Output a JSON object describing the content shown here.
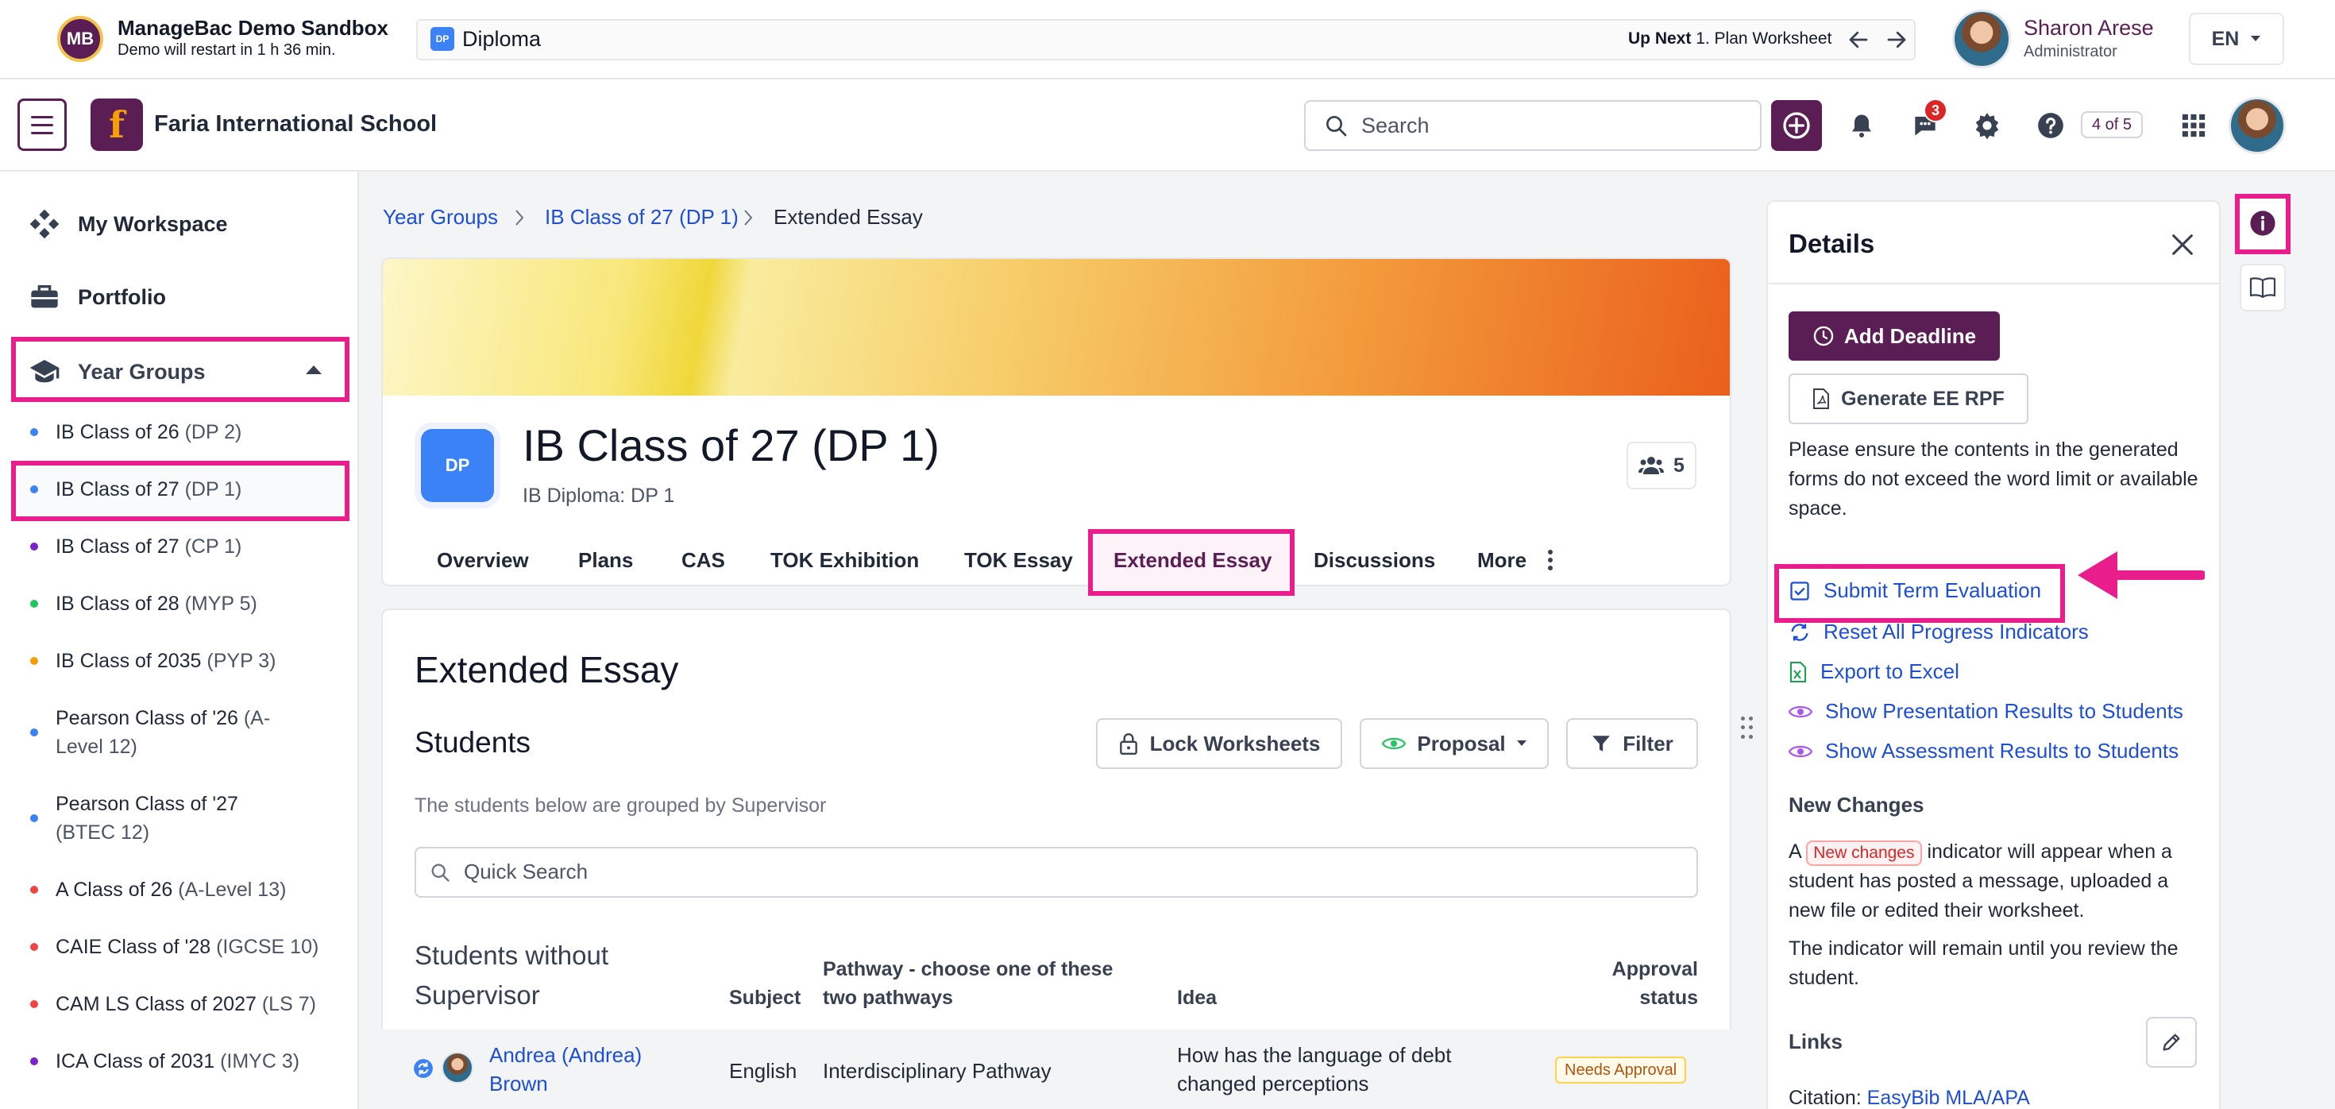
{
  "demo": {
    "logo_text": "MB",
    "title": "ManageBac Demo Sandbox",
    "subtitle": "Demo will restart in 1 h 36 min.",
    "program_icon": "DP",
    "program": "Diploma",
    "up_next_label": "Up Next",
    "up_next_value": "1. Plan Worksheet",
    "user_name": "Sharon Arese",
    "user_role": "Administrator",
    "language": "EN"
  },
  "header": {
    "school_logo": "f",
    "school_name": "Faria International School",
    "search_placeholder": "Search",
    "messages_badge": "3",
    "guide_progress": "4 of 5"
  },
  "sidebar": {
    "my_workspace": "My Workspace",
    "portfolio": "Portfolio",
    "year_groups": "Year Groups",
    "classes": [
      {
        "name": "IB Class of 26",
        "tag": "(DP 2)",
        "color": "#3b82f6"
      },
      {
        "name": "IB Class of 27",
        "tag": "(DP 1)",
        "color": "#3b82f6"
      },
      {
        "name": "IB Class of 27",
        "tag": "(CP 1)",
        "color": "#7e22ce"
      },
      {
        "name": "IB Class of 28",
        "tag": "(MYP 5)",
        "color": "#22c55e"
      },
      {
        "name": "IB Class of 2035",
        "tag": "(PYP 3)",
        "color": "#f59e0b"
      },
      {
        "name": "Pearson Class of '26",
        "tag": "(A-Level 12)",
        "color": "#3b82f6"
      },
      {
        "name": "Pearson Class of '27",
        "tag": "(BTEC 12)",
        "color": "#3b82f6"
      },
      {
        "name": "A Class of 26",
        "tag": "(A-Level 13)",
        "color": "#ef4444"
      },
      {
        "name": "CAIE Class of '28",
        "tag": "(IGCSE 10)",
        "color": "#ef4444"
      },
      {
        "name": "CAM LS Class of 2027",
        "tag": "(LS 7)",
        "color": "#ef4444"
      },
      {
        "name": "ICA Class of 2031",
        "tag": "(IMYC 3)",
        "color": "#7e22ce"
      }
    ]
  },
  "breadcrumb": {
    "item1": "Year Groups",
    "item2": "IB Class of 27 (DP 1)",
    "current": "Extended Essay"
  },
  "class": {
    "logo": "DP",
    "title": "IB Class of 27 (DP 1)",
    "subtitle": "IB Diploma: DP 1",
    "member_count": "5"
  },
  "tabs": {
    "overview": "Overview",
    "plans": "Plans",
    "cas": "CAS",
    "tok_exhibition": "TOK Exhibition",
    "tok_essay": "TOK Essay",
    "extended_essay": "Extended Essay",
    "discussions": "Discussions",
    "more": "More"
  },
  "main": {
    "title": "Extended Essay",
    "students_heading": "Students",
    "lock_worksheets": "Lock Worksheets",
    "proposal": "Proposal",
    "filter": "Filter",
    "grouped_note": "The students below are grouped by Supervisor",
    "quick_search_placeholder": "Quick Search",
    "group_title": "Students without Supervisor",
    "columns": {
      "subject": "Subject",
      "pathway_line1": "Pathway - choose one of these",
      "pathway_line2": "two pathways",
      "idea": "Idea",
      "approval_line1": "Approval",
      "approval_line2": "status"
    },
    "row": {
      "student_line1": "Andrea (Andrea)",
      "student_line2": "Brown",
      "subject": "English",
      "pathway": "Interdisciplinary Pathway",
      "idea_line1": "How has the language of debt",
      "idea_line2": "changed perceptions",
      "status": "Needs Approval"
    }
  },
  "details": {
    "title": "Details",
    "add_deadline": "Add Deadline",
    "generate_rpf": "Generate EE RPF",
    "ensure_note": "Please ensure the contents in the generated forms do not exceed the word limit or available space.",
    "actions": {
      "submit_term_evaluation": "Submit Term Evaluation",
      "reset_progress": "Reset All Progress Indicators",
      "export_excel": "Export to Excel",
      "show_presentation": "Show Presentation Results to Students",
      "show_assessment": "Show Assessment Results to Students"
    },
    "new_changes_heading": "New Changes",
    "new_changes_prefix": "A",
    "new_changes_pill": "New changes",
    "new_changes_suffix": "indicator will appear when a student has posted a message, uploaded a new file or edited their worksheet.",
    "remain_note": "The indicator will remain until you review the student.",
    "links_heading": "Links",
    "citation_label": "Citation:",
    "citation_link": "EasyBib MLA/APA"
  }
}
